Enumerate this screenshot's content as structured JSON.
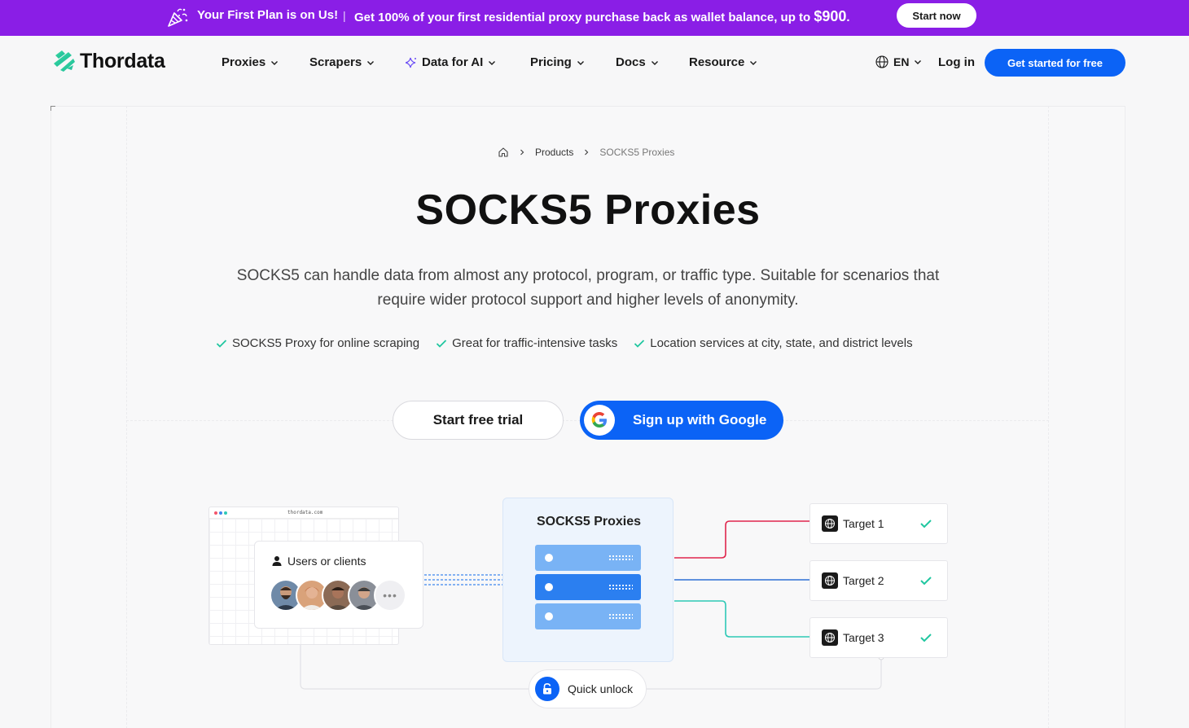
{
  "promo": {
    "headline": "Your First Plan is on Us!",
    "separator": "|",
    "message": "Get 100% of your first residential proxy purchase back as wallet balance, up to ",
    "amount": "$900",
    "period": ".",
    "button": "Start now",
    "bg_color": "#8a1ee6"
  },
  "nav": {
    "logo": "Thordata",
    "items": [
      "Proxies",
      "Scrapers",
      "Data for AI",
      "Pricing",
      "Docs",
      "Resource"
    ],
    "language": "EN",
    "login": "Log in",
    "cta": "Get started for free",
    "accent_color": "#0b63f6"
  },
  "breadcrumb": {
    "home_icon": "home-icon",
    "items": [
      "Products",
      "SOCKS5 Proxies"
    ]
  },
  "hero": {
    "title": "SOCKS5 Proxies",
    "subtitle": "SOCKS5 can handle data from almost any protocol, program, or traffic type. Suitable for scenarios that require wider protocol support and higher levels of anonymity.",
    "features": [
      "SOCKS5 Proxy for online scraping",
      "Great for traffic-intensive tasks",
      "Location services at city, state, and district levels"
    ],
    "primary_button": "Start free trial",
    "google_button": "Sign up with Google"
  },
  "diagram": {
    "browser_url": "thordata.com",
    "users_label": "Users or clients",
    "more_avatars": "•••",
    "proxies_label": "SOCKS5 Proxies",
    "targets": [
      "Target 1",
      "Target 2",
      "Target 3"
    ],
    "unlock_label": "Quick unlock",
    "colors": {
      "target1_line": "#e0264d",
      "target2_line": "#2e6fd6",
      "target3_line": "#2ec9b6",
      "check": "#20c7a0"
    }
  }
}
